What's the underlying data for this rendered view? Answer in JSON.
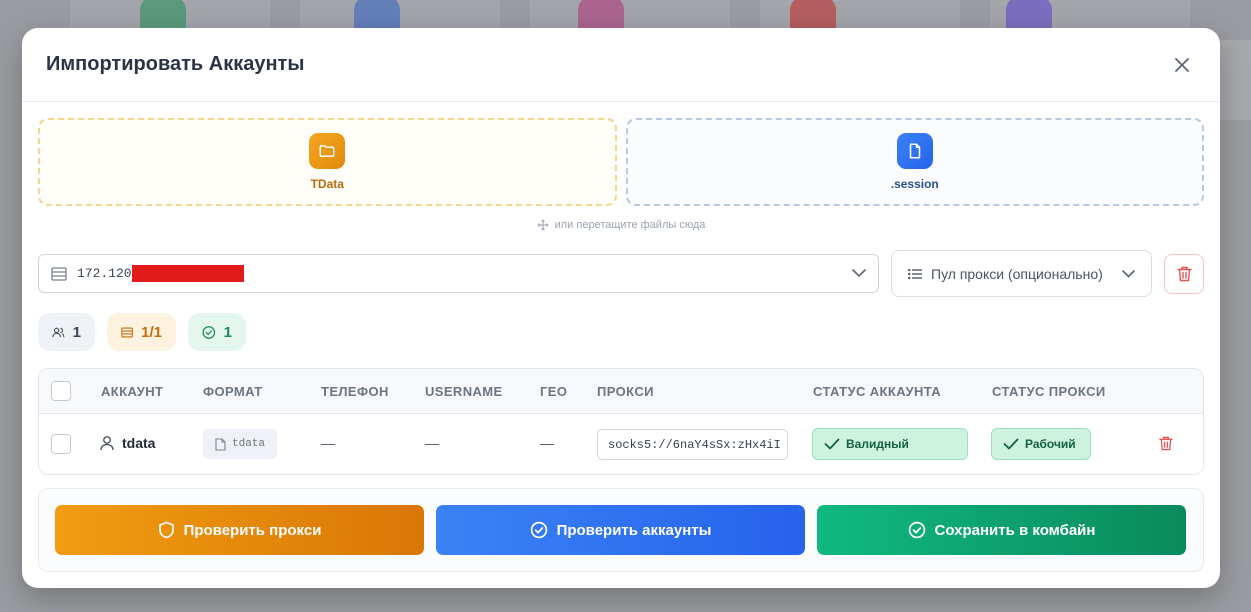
{
  "modal": {
    "title": "Импортировать Аккаунты"
  },
  "dropzones": {
    "tdata_label": "TData",
    "session_label": ".session",
    "hint": "или перетащите файлы сюда"
  },
  "proxy": {
    "value": "172.120"
  },
  "pool": {
    "label": "Пул прокси (опционально)"
  },
  "stats": {
    "accounts": "1",
    "proxies": "1/1",
    "valid": "1"
  },
  "table": {
    "headers": {
      "account": "АККАУНТ",
      "format": "ФОРМАТ",
      "phone": "ТЕЛЕФОН",
      "username": "USERNAME",
      "geo": "ГЕО",
      "proxy": "ПРОКСИ",
      "account_status": "СТАТУС АККАУНТА",
      "proxy_status": "СТАТУС ПРОКСИ"
    },
    "rows": [
      {
        "account": "tdata",
        "format": "tdata",
        "phone": "—",
        "username": "—",
        "geo": "—",
        "proxy": "socks5://6naY4sSx:zHx4iI",
        "account_status": "Валидный",
        "proxy_status": "Рабочий"
      }
    ]
  },
  "actions": {
    "check_proxy": "Проверить прокси",
    "check_accounts": "Проверить аккаунты",
    "save": "Сохранить в комбайн"
  },
  "colors": {
    "orange": "#f19c11",
    "blue": "#3b82f6",
    "green": "#10b981",
    "danger": "#e25555"
  }
}
